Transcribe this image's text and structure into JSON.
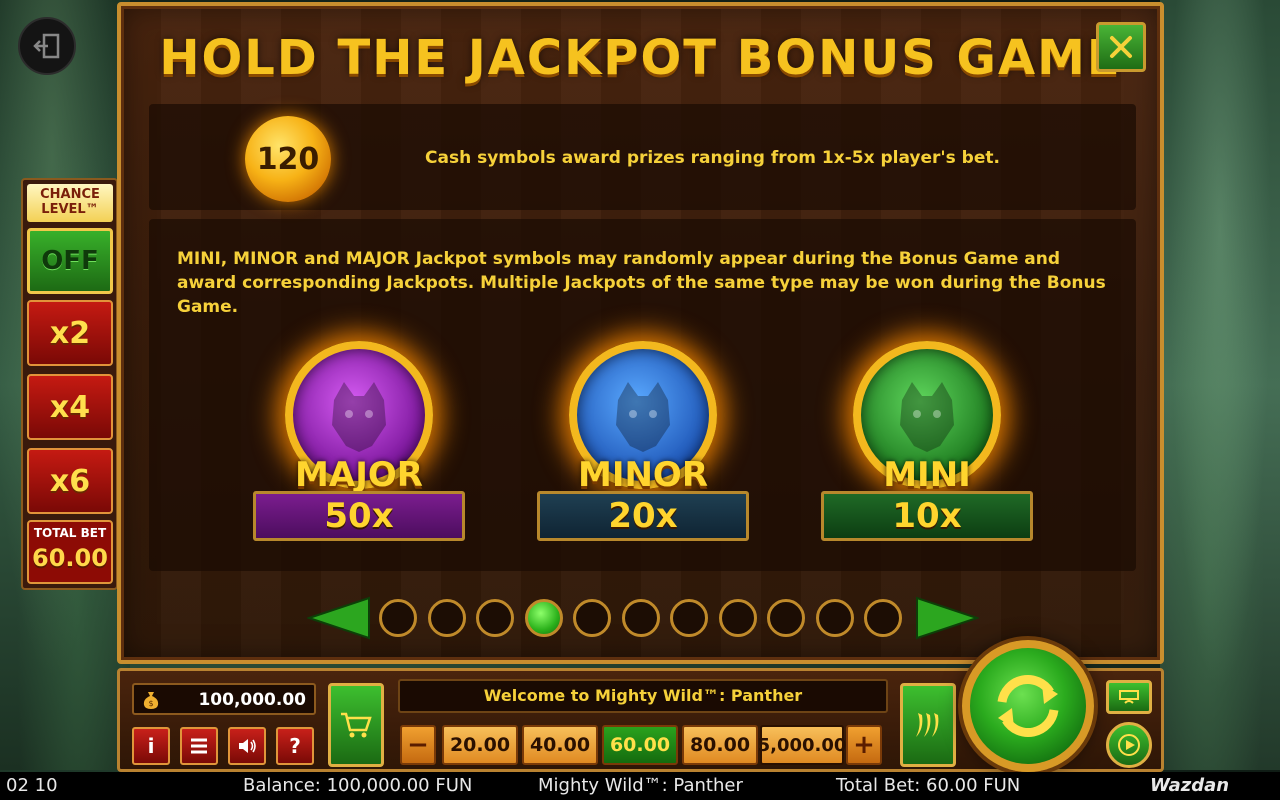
{
  "panel": {
    "title": "HOLD THE JACKPOT BONUS GAME",
    "cash_value": "120",
    "cash_text": "Cash symbols award prizes ranging from 1x-5x player's bet.",
    "jackpot_text": "MINI, MINOR and MAJOR Jackpot symbols may randomly appear during the Bonus Game and award corresponding Jackpots. Multiple Jackpots of the same type may be won during the Bonus Game."
  },
  "jackpots": [
    {
      "name": "MAJOR",
      "multiplier": "50x",
      "color": "#8e24aa"
    },
    {
      "name": "MINOR",
      "multiplier": "20x",
      "color": "#1e5fc0"
    },
    {
      "name": "MINI",
      "multiplier": "10x",
      "color": "#2e8b2e"
    }
  ],
  "pager": {
    "total_pages": 11,
    "current_page": 4
  },
  "chance_level": {
    "title": "CHANCE\nLEVEL™",
    "off_label": "OFF",
    "options": [
      "x2",
      "x4",
      "x6"
    ],
    "total_bet_label": "TOTAL BET",
    "total_bet_value": "60.00"
  },
  "controls": {
    "balance": "100,000.00",
    "message": "Welcome to Mighty Wild™: Panther",
    "minus": "−",
    "plus": "+",
    "bet_options": [
      "20.00",
      "40.00",
      "60.00",
      "80.00",
      "5,000.00"
    ],
    "selected_bet": "60.00",
    "info": "i",
    "help": "?"
  },
  "status_bar": {
    "time": "02 10",
    "balance": "Balance: 100,000.00 FUN",
    "title": "Mighty Wild™: Panther",
    "total_bet": "Total Bet: 60.00 FUN",
    "logo": "Wazdan"
  },
  "icons": {
    "exit": "exit-icon",
    "close": "close-icon",
    "money_bag": "money-bag-icon",
    "menu": "menu-icon",
    "sound": "speaker-icon",
    "cart": "cart-icon",
    "turbo": "chili-peppers-icon",
    "spin": "spin-arrows-icon",
    "settings": "settings-icon",
    "autoplay": "play-icon"
  }
}
